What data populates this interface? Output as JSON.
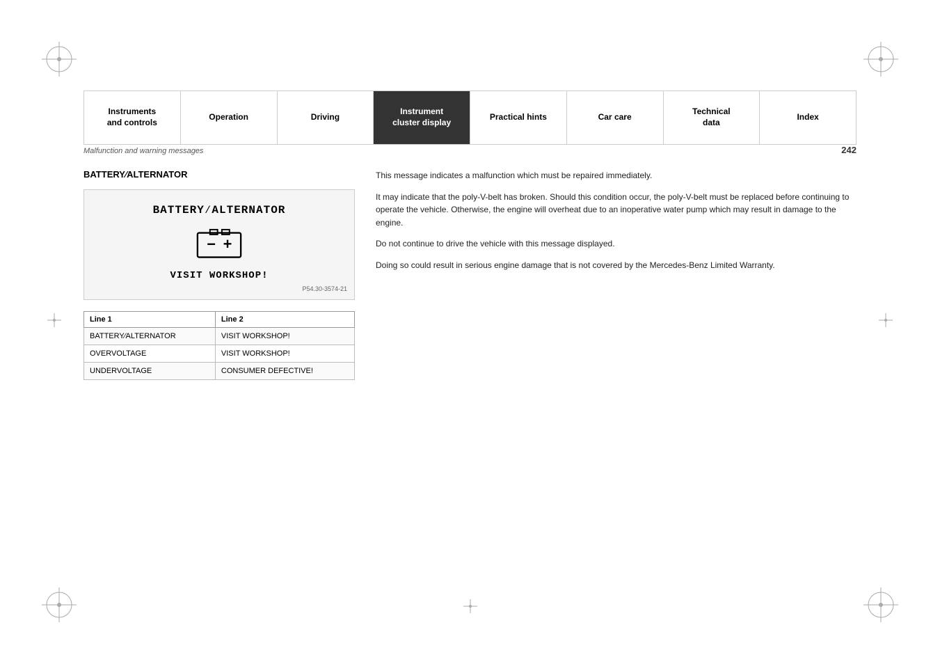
{
  "nav": {
    "items": [
      {
        "id": "instruments-controls",
        "label": "Instruments\nand controls",
        "active": false,
        "bold": true
      },
      {
        "id": "operation",
        "label": "Operation",
        "active": false
      },
      {
        "id": "driving",
        "label": "Driving",
        "active": false
      },
      {
        "id": "instrument-cluster-display",
        "label": "Instrument\ncluster display",
        "active": true
      },
      {
        "id": "practical-hints",
        "label": "Practical hints",
        "active": false
      },
      {
        "id": "car-care",
        "label": "Car care",
        "active": false
      },
      {
        "id": "technical-data",
        "label": "Technical\ndata",
        "active": false
      },
      {
        "id": "index",
        "label": "Index",
        "active": false
      }
    ]
  },
  "subheader": {
    "section_title": "Malfunction and warning messages",
    "page_number": "242"
  },
  "section": {
    "heading": "BATTERY⁄ALTERNATOR",
    "battery_display_line1": "BATTERY⁄ALTERNATOR",
    "visit_workshop": "VISIT WORKSHOP!",
    "image_ref": "P54.30-3574-21"
  },
  "table": {
    "col1_header": "Line 1",
    "col2_header": "Line 2",
    "rows": [
      {
        "line1": "BATTERY⁄ALTERNATOR",
        "line2": "VISIT WORKSHOP!"
      },
      {
        "line1": "OVERVOLTAGE",
        "line2": "VISIT WORKSHOP!"
      },
      {
        "line1": "UNDERVOLTAGE",
        "line2": "CONSUMER DEFECTIVE!"
      }
    ]
  },
  "right_text": {
    "para1": "This message indicates a malfunction which must be repaired immediately.",
    "para2": "It may indicate that the poly-V-belt has broken. Should this condition occur, the poly-V-belt must be replaced before continuing to operate the vehicle. Otherwise, the engine will overheat due to an inoperative water pump which may result in damage to the engine.",
    "para3": "Do not continue to drive the vehicle with this message displayed.",
    "para4": "Doing so could result in serious engine damage that is not covered by the Mercedes-Benz Limited Warranty."
  }
}
